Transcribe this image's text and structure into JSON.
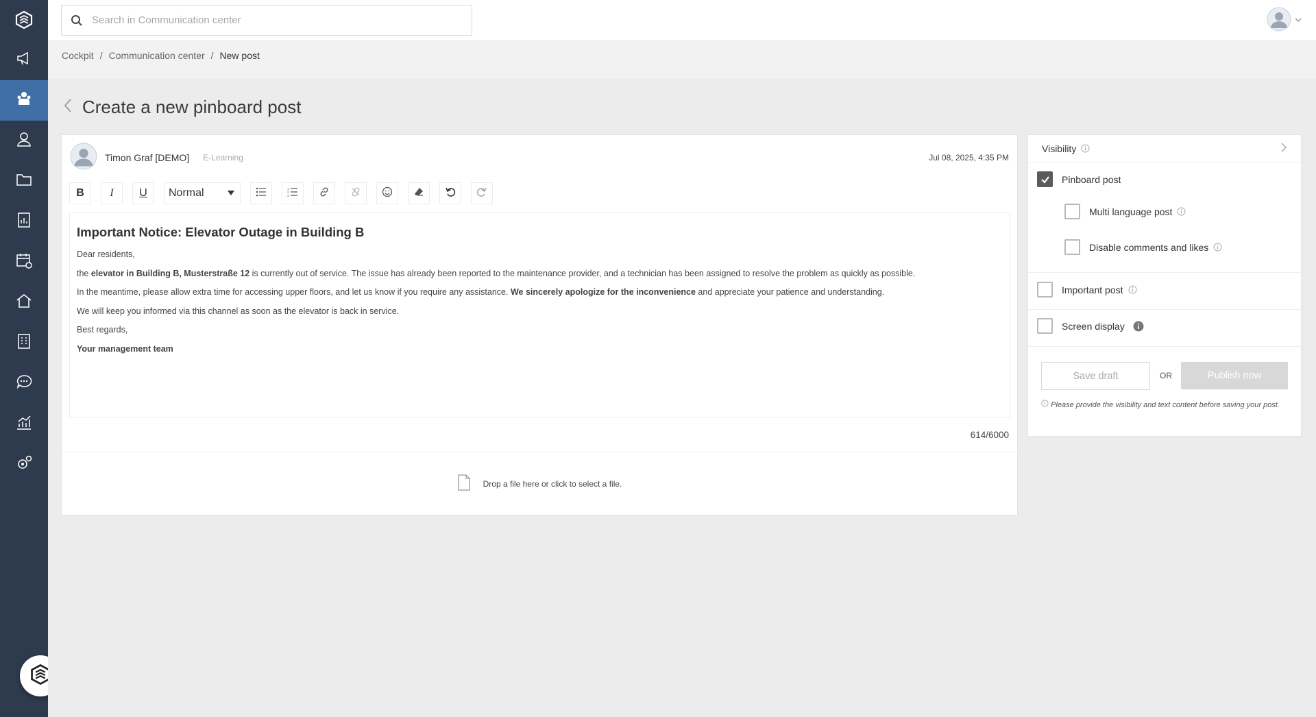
{
  "search": {
    "placeholder": "Search in Communication center"
  },
  "breadcrumb": {
    "items": [
      "Cockpit",
      "Communication center"
    ],
    "current": "New post",
    "separator": "/"
  },
  "page": {
    "title": "Create a new pinboard post"
  },
  "post": {
    "author": "Timon Graf [DEMO]",
    "role": "E-Learning",
    "date": "Jul 08, 2025, 4:35 PM",
    "toolbar": {
      "format_label": "Normal"
    },
    "content": {
      "heading": "Important Notice: Elevator Outage in Building B",
      "greeting": "Dear residents,",
      "p1_pre": "the ",
      "p1_bold": "elevator in Building B, Musterstraße 12",
      "p1_post": " is currently out of service. The issue has already been reported to the maintenance provider, and a technician has been assigned to resolve the problem as quickly as possible.",
      "p2_pre": "In the meantime, please allow extra time for accessing upper floors, and let us know if you require any assistance. ",
      "p2_bold": "We sincerely apologize for the inconvenience",
      "p2_post": " and appreciate your patience and understanding.",
      "p3": "We will keep you informed via this channel as soon as the elevator is back in service.",
      "closing": "Best regards,",
      "signature": "Your management team"
    },
    "char_count": "614/6000",
    "dropzone_text": "Drop a file here or click to select a file."
  },
  "visibility": {
    "title": "Visibility",
    "options": {
      "pinboard_post": {
        "label": "Pinboard post",
        "checked": true
      },
      "multi_language": {
        "label": "Multi language post",
        "checked": false
      },
      "disable_comments": {
        "label": "Disable comments and likes",
        "checked": false
      },
      "important_post": {
        "label": "Important post",
        "checked": false
      },
      "screen_display": {
        "label": "Screen display",
        "checked": false
      }
    },
    "save_draft_label": "Save draft",
    "or_label": "OR",
    "publish_label": "Publish now",
    "hint": "Please provide the visibility and text content before saving your post."
  },
  "colors": {
    "sidebar": "#2e3b4e",
    "sidebar_active": "#3f6fa6",
    "checkbox_checked": "#5b5b5b",
    "notification_dot": "#3c86d6"
  },
  "icons": [
    "logo-icon",
    "megaphone-icon",
    "community-icon",
    "user-icon",
    "folder-icon",
    "report-icon",
    "calendar-icon",
    "home-icon",
    "building-icon",
    "chat-icon",
    "analytics-icon",
    "settings-icon",
    "assistant-icon"
  ]
}
